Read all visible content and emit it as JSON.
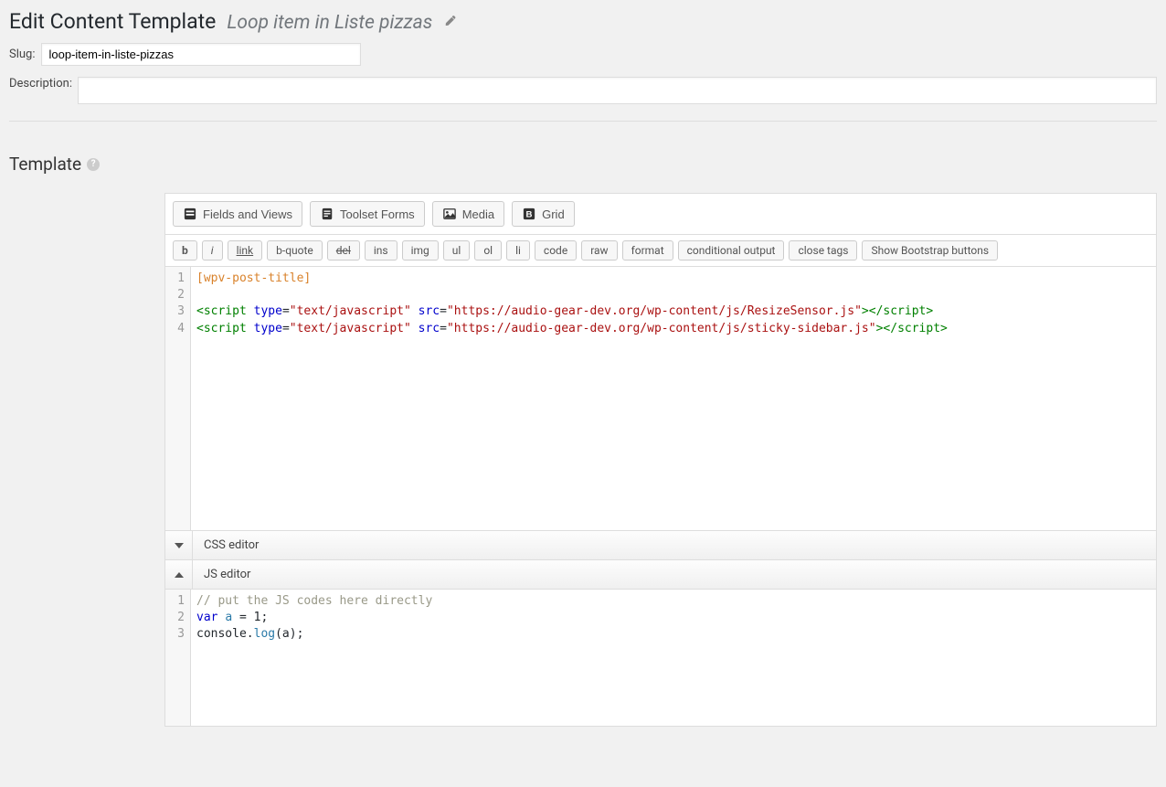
{
  "header": {
    "page_title": "Edit Content Template",
    "item_title": "Loop item in Liste pizzas"
  },
  "fields": {
    "slug_label": "Slug:",
    "slug_value": "loop-item-in-liste-pizzas",
    "description_label": "Description:",
    "description_value": ""
  },
  "section": {
    "template_heading": "Template"
  },
  "toolbar_main": {
    "fields_views": "Fields and Views",
    "toolset_forms": "Toolset Forms",
    "media": "Media",
    "grid": "Grid"
  },
  "toolbar_sec": {
    "b": "b",
    "i": "i",
    "link": "link",
    "b_quote": "b-quote",
    "del": "del",
    "ins": "ins",
    "img": "img",
    "ul": "ul",
    "ol": "ol",
    "li": "li",
    "code": "code",
    "raw": "raw",
    "format": "format",
    "cond": "conditional output",
    "close": "close tags",
    "bootstrap": "Show Bootstrap buttons"
  },
  "code": {
    "lines": [
      "1",
      "2",
      "3",
      "4"
    ],
    "l1_shortcode": "[wpv-post-title]",
    "l3_open": "<",
    "l3_tag": "script",
    "l3_sp": " ",
    "l3_attr1": "type",
    "l3_eq": "=",
    "l3_val1": "\"text/javascript\"",
    "l3_attr2": "src",
    "l3_val2": "\"https://audio-gear-dev.org/wp-content/js/ResizeSensor.js\"",
    "l3_close1": ">",
    "l3_close2": "</",
    "l3_close3": ">",
    "l4_val2": "\"https://audio-gear-dev.org/wp-content/js/sticky-sidebar.js\""
  },
  "panels": {
    "css_label": "CSS editor",
    "js_label": "JS editor"
  },
  "js": {
    "lines": [
      "1",
      "2",
      "3"
    ],
    "l1_cmt": "// put the JS codes here directly",
    "l2_kw": "var",
    "l2_sp": " ",
    "l2_var": "a",
    "l2_rest": " = 1;",
    "l3_a": "console.",
    "l3_b": "log",
    "l3_c": "(a);"
  }
}
